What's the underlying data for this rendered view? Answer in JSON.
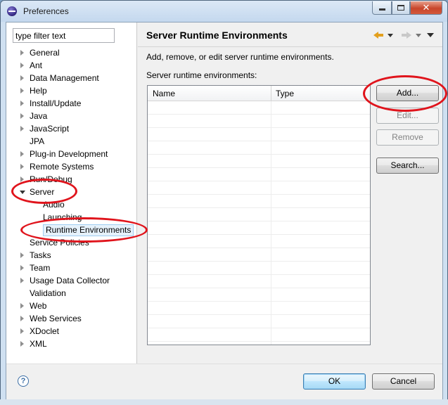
{
  "window": {
    "title": "Preferences",
    "colors": {
      "titlebar": "#c4d8ee",
      "close": "#c8452b",
      "annotation": "#e0141c"
    }
  },
  "filter": {
    "value": "type filter text"
  },
  "tree": {
    "items": [
      {
        "label": "General",
        "expandable": true
      },
      {
        "label": "Ant",
        "expandable": true
      },
      {
        "label": "Data Management",
        "expandable": true
      },
      {
        "label": "Help",
        "expandable": true
      },
      {
        "label": "Install/Update",
        "expandable": true
      },
      {
        "label": "Java",
        "expandable": true
      },
      {
        "label": "JavaScript",
        "expandable": true
      },
      {
        "label": "JPA",
        "expandable": false
      },
      {
        "label": "Plug-in Development",
        "expandable": true
      },
      {
        "label": "Remote Systems",
        "expandable": true
      },
      {
        "label": "Run/Debug",
        "expandable": true
      },
      {
        "label": "Server",
        "expandable": true,
        "expanded": true
      },
      {
        "label": "Audio",
        "child": true
      },
      {
        "label": "Launching",
        "child": true
      },
      {
        "label": "Runtime Environments",
        "child": true,
        "selected": true
      },
      {
        "label": "Service Policies",
        "expandable": false
      },
      {
        "label": "Tasks",
        "expandable": true
      },
      {
        "label": "Team",
        "expandable": true
      },
      {
        "label": "Usage Data Collector",
        "expandable": true
      },
      {
        "label": "Validation",
        "expandable": false
      },
      {
        "label": "Web",
        "expandable": true
      },
      {
        "label": "Web Services",
        "expandable": true
      },
      {
        "label": "XDoclet",
        "expandable": true
      },
      {
        "label": "XML",
        "expandable": true
      }
    ]
  },
  "page": {
    "title": "Server Runtime Environments",
    "description": "Add, remove, or edit server runtime environments.",
    "list_label": "Server runtime environments:",
    "table": {
      "columns": [
        "Name",
        "Type"
      ],
      "rows": []
    },
    "buttons": {
      "add": "Add...",
      "edit": "Edit...",
      "remove": "Remove",
      "search": "Search..."
    }
  },
  "dialog": {
    "help_icon": "question-icon",
    "ok": "OK",
    "cancel": "Cancel"
  }
}
